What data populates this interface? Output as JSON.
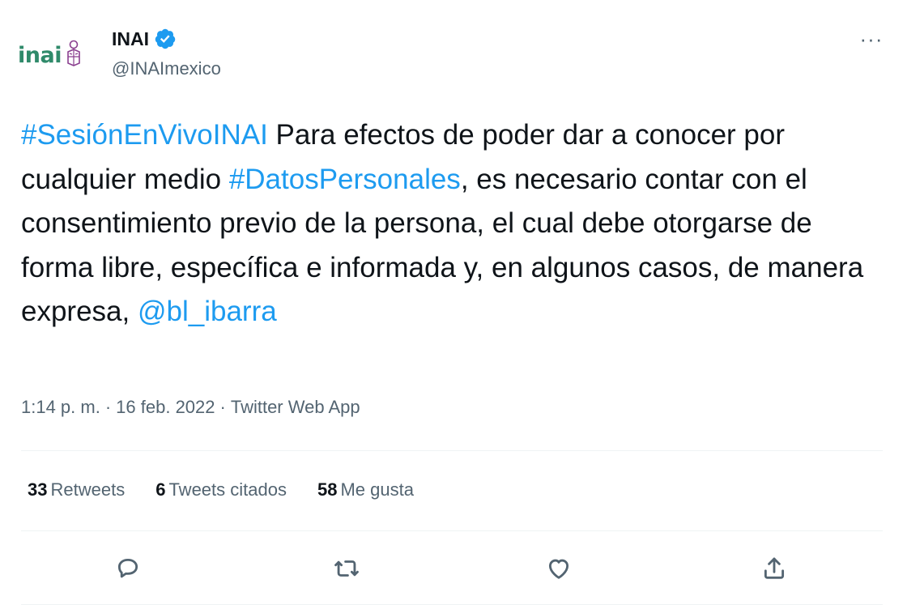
{
  "tweet": {
    "avatar_text": "inai",
    "display_name": "INAI",
    "handle": "@INAImexico",
    "more_label": "···",
    "text_segments": [
      {
        "text": "#SesiónEnVivoINAI",
        "link": true
      },
      {
        "text": " Para efectos de poder dar a conocer por cualquier medio ",
        "link": false
      },
      {
        "text": "#DatosPersonales",
        "link": true
      },
      {
        "text": ", es necesario contar con el consentimiento previo de la persona, el cual debe otorgarse de forma libre, específica e informada y, en algunos casos, de manera expresa, ",
        "link": false
      },
      {
        "text": "@bl_ibarra",
        "link": true
      }
    ],
    "time": "1:14 p. m.",
    "date": "16 feb. 2022",
    "app": "Twitter Web App",
    "separator": "·",
    "stats": [
      {
        "count": "33",
        "label": "Retweets"
      },
      {
        "count": "6",
        "label": "Tweets citados"
      },
      {
        "count": "58",
        "label": "Me gusta"
      }
    ],
    "actions": [
      "reply-icon",
      "retweet-icon",
      "like-icon",
      "share-icon"
    ]
  },
  "colors": {
    "link": "#1d9bf0",
    "text": "#0f1419",
    "secondary": "#536471",
    "divider": "#eff3f4",
    "logo": "#2f8a6a",
    "logo_icon": "#8a3f8f"
  }
}
